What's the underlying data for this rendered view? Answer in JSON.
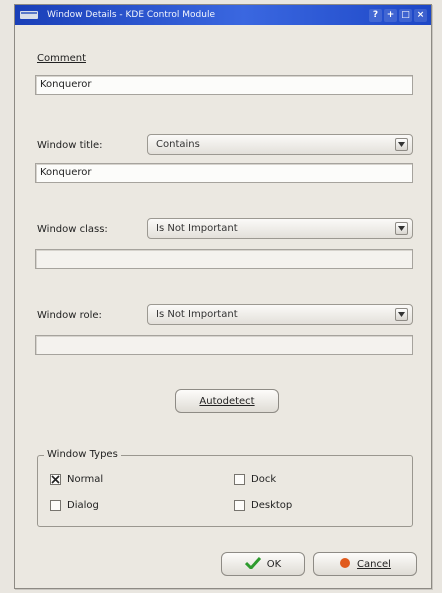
{
  "window": {
    "title": "Window Details - KDE Control Module",
    "titlebar_buttons": [
      "?",
      "+",
      "□",
      "×"
    ]
  },
  "comment": {
    "label": "Comment",
    "value": "Konqueror"
  },
  "window_title": {
    "label": "Window title:",
    "match_type": "Contains",
    "value": "Konqueror"
  },
  "window_class": {
    "label": "Window class:",
    "match_type": "Is Not Important",
    "value": ""
  },
  "window_role": {
    "label": "Window role:",
    "match_type": "Is Not Important",
    "value": ""
  },
  "autodetect": {
    "label": "Autodetect"
  },
  "window_types": {
    "title": "Window Types",
    "items": [
      {
        "label": "Normal",
        "checked": true
      },
      {
        "label": "Dock",
        "checked": false
      },
      {
        "label": "Dialog",
        "checked": false
      },
      {
        "label": "Desktop",
        "checked": false
      }
    ]
  },
  "buttons": {
    "ok": "OK",
    "cancel": "Cancel"
  },
  "colors": {
    "titlebar": "#1d47c6",
    "ok_check": "#2e9b2e",
    "cancel_icon": "#e05a1c"
  }
}
